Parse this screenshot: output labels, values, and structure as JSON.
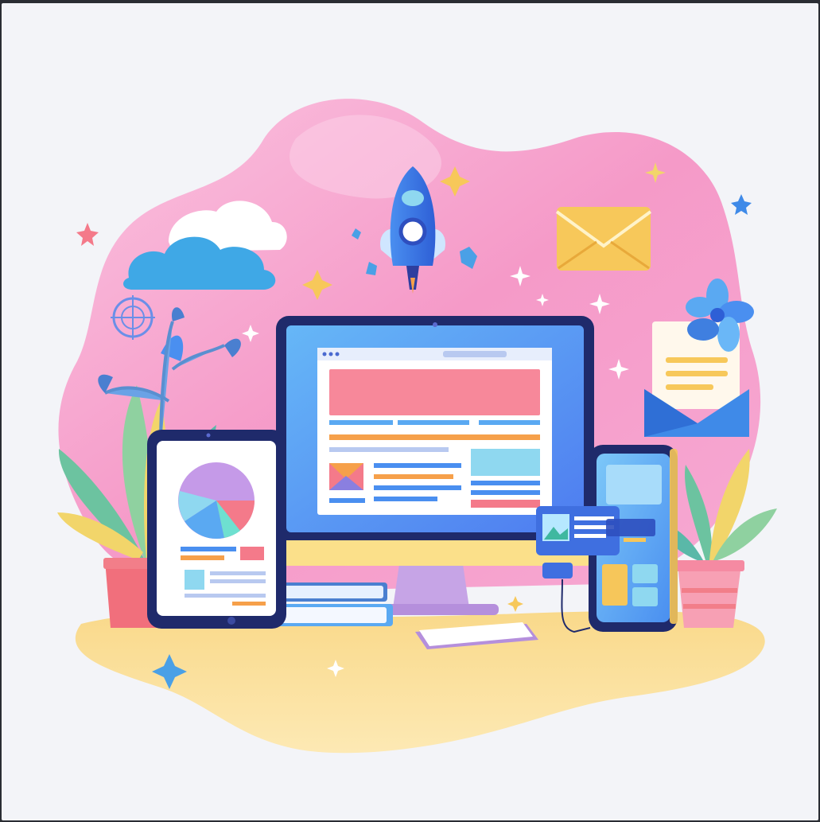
{
  "illustration": {
    "subject": "",
    "colors": {
      "background": "#f3f4f8",
      "blob_pink": "#f59ac8",
      "blob_pink_light": "#fbc3e0",
      "ground_yellow": "#fbe08a",
      "monitor_frame": "#1f2a6b",
      "screen_blue": "#5aa9f2",
      "accent_coral": "#f47a8a",
      "accent_orange": "#f6a04a",
      "envelope_yellow": "#f7c85a",
      "plant_green": "#6cc3a0"
    },
    "icons": [
      "cloud-icon",
      "rocket-icon",
      "mail-envelope-icon",
      "open-letter-icon",
      "flower-icon",
      "compass-icon",
      "desktop-monitor-icon",
      "tablet-icon",
      "pie-chart-icon",
      "smartphone-icon",
      "chat-card-icon",
      "keyboard-icon",
      "books-icon",
      "plant-pot-icon",
      "sparkle-icon",
      "star-icon"
    ]
  }
}
